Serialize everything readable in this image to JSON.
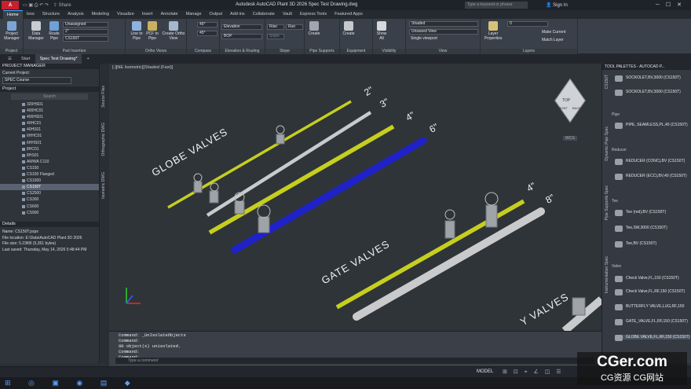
{
  "app": {
    "logo": "A",
    "title": "Autodesk AutoCAD Plant 3D 2026  Spec Test Drawing.dwg",
    "share": "Share",
    "search_placeholder": "Type a keyword or phrase",
    "sign_in": "Sign In"
  },
  "ribbon_tabs": [
    "Home",
    "Isos",
    "Structure",
    "Analysis",
    "Modeling",
    "Visualize",
    "Insert",
    "Annotate",
    "Manage",
    "Output",
    "Add-ins",
    "Collaborate",
    "Vault",
    "Express Tools",
    "Featured Apps"
  ],
  "ribbon": {
    "project": {
      "manager": "Project Manager",
      "label": "Project"
    },
    "part_insertion": {
      "data_manager": "Data Manager",
      "route_pipe": "Route Pipe",
      "combo1": "Unassigned",
      "combo2": "2\"",
      "combo3": "CS150T",
      "label": "Part Insertion"
    },
    "ortho": {
      "line_to_pipe": "Line to Pipe",
      "pcf": "PCF to Pipe",
      "create": "Create Ortho View",
      "label": "Ortho Views"
    },
    "compass": {
      "a1": "45°",
      "a2": "45°",
      "label": "Compass"
    },
    "elevation": {
      "elevation": "Elevation",
      "bop": "BOP",
      "label": "Elevation & Routing"
    },
    "slope": {
      "rise": "Rise",
      "run": "Run",
      "slope": "Slope",
      "label": "Slope"
    },
    "pipe_supports": {
      "create": "Create",
      "label": "Pipe Supports"
    },
    "equipment": {
      "create": "Create",
      "label": "Equipment"
    },
    "visibility": {
      "show_all": "Show All",
      "label": "Visibility"
    },
    "view": {
      "visual_style": "Shaded",
      "saved_view": "Unsaved View",
      "single_viewport": "Single viewport",
      "label": "View"
    },
    "layers": {
      "layer_properties": "Layer Properties",
      "layer_value": "0",
      "make_current": "Make Current",
      "match_layer": "Match Layer",
      "label": "Layers"
    }
  },
  "doc_tabs": [
    "Start",
    "Spec Test Drawing*"
  ],
  "project_manager": {
    "title": "PROJECT MANAGER",
    "current_project_label": "Current Project:",
    "current_project": "SPEC Course",
    "project_label": "Project",
    "search": "Search",
    "items": [
      "320HS01",
      "400HC01",
      "400HS01",
      "40HC01",
      "40HS01",
      "6HHC01",
      "6HHS01",
      "8HC01",
      "8HS01",
      "AWWA C110",
      "CS150",
      "CS150 Flanged",
      "CS1500",
      "CS150T",
      "CS2500",
      "CS300",
      "CS600",
      "CS900"
    ],
    "selected": "CS150T",
    "details_title": "Details",
    "details": [
      "Name:  CS150T.pspx",
      "File location:  E:\\Data\\AutoCAD Plant 3D 2026",
      "File size:  5.23KB (5,351 bytes)",
      "Last saved:  Thursday, May 14, 2026 5:48:44 PM"
    ]
  },
  "side_tabs": [
    "Source Files",
    "Orthographic DWG",
    "Isometric DWG"
  ],
  "viewport": {
    "label": "[-][NE Isometric][Shaded (Fast)]",
    "viewcube_top": "TOP",
    "viewcube_front": "FRONT",
    "viewcube_back": "BACK",
    "wcs": "WCS",
    "labels": {
      "globe": "GLOBE VALVES",
      "gate": "GATE VALVES",
      "check": "Y VALVES",
      "s2": "2\"",
      "s3": "3\"",
      "s4a": "4\"",
      "s6": "6\"",
      "s4b": "4\"",
      "s8": "8\""
    }
  },
  "command": {
    "lines": [
      "Command: _UnIsolateObjects",
      "Command:",
      "80 object(s) unisolated.",
      "Command:",
      "Command:"
    ],
    "placeholder": "Type a command"
  },
  "tool_palette": {
    "title": "TOOL PALETTES - AUTOCAD P...",
    "side_tabs": [
      "CS150T",
      "Dynamic Pipe Spec",
      "Pipe Supports Spec",
      "Instrumentation Spec"
    ],
    "items": [
      "SOCKOLET,BV,3000 (CS150T)",
      "SOCKOLET,BV,3000 (CS150T)",
      "PIPE, SEAMLESS,PL,40 (CS150T)",
      "REDUCER (CONC),BV (CS150T)",
      "REDUCER (ECC),BV,40 (CS150T)",
      "Tee (red),BV (CS150T)",
      "Tee,SW,3000 (CS150T)",
      "Tee,BV (CS150T)",
      "Check Valve,FL,150 (CS150T)",
      "Check Valve,FL,RF,150 (CS150T)",
      "BUTTERFLY VALVE,LUG,RF,150",
      "GATE_VALVE,FL,RF,150 (CS150T)",
      "GLOBE VALVE,FL,RF,150 (CS150T)"
    ],
    "sections": [
      "Pipe",
      "Reducer",
      "Tee",
      "Valve"
    ]
  },
  "status": {
    "model": "MODEL"
  },
  "watermark": {
    "line1": "CGer.com",
    "line2": "CG资源 CG网站"
  },
  "colors": {
    "accent": "#c8202f",
    "pipe_yellow": "#c6cf1e",
    "pipe_gray": "#c8cacc",
    "pipe_blue": "#1f22c8"
  }
}
